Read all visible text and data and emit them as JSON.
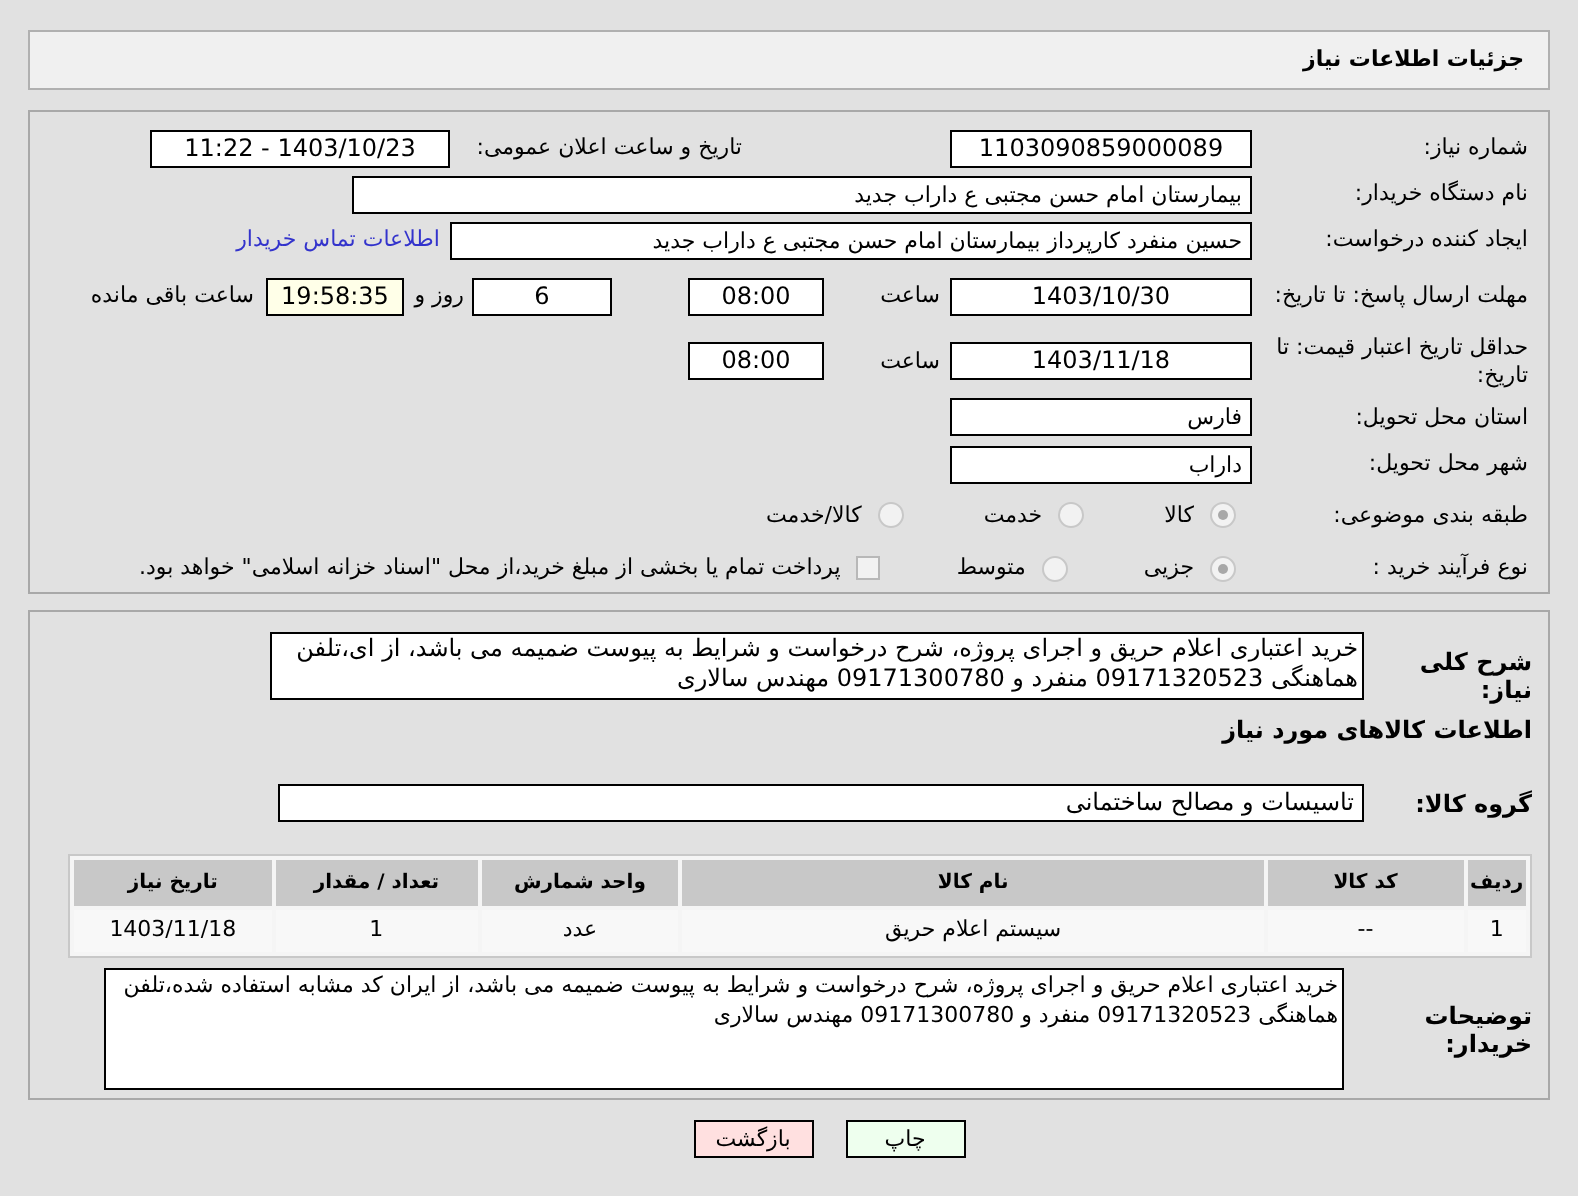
{
  "header": {
    "title": "جزئیات اطلاعات نیاز"
  },
  "need_number": {
    "label": "شماره نیاز:",
    "value": "1103090859000089"
  },
  "announce": {
    "label": "تاریخ و ساعت اعلان عمومی:",
    "value": "1403/10/23 - 11:22"
  },
  "buyer_org": {
    "label": "نام دستگاه خریدار:",
    "value": "بیمارستان امام حسن مجتبی  ع  داراب جدید"
  },
  "requester": {
    "label": "ایجاد کننده درخواست:",
    "value": "حسین  منفرد کارپرداز بیمارستان امام حسن مجتبی  ع  داراب جدید",
    "link": "اطلاعات تماس خریدار"
  },
  "deadline": {
    "label": "مهلت ارسال پاسخ: تا تاریخ:",
    "date": "1403/10/30",
    "time_label": "ساعت",
    "time": "08:00",
    "days": "6",
    "days_label": "روز و",
    "remaining": "19:58:35",
    "remaining_label": "ساعت باقی مانده"
  },
  "validity": {
    "label": "حداقل تاریخ اعتبار قیمت: تا تاریخ:",
    "date": "1403/11/18",
    "time_label": "ساعت",
    "time": "08:00"
  },
  "province": {
    "label": "استان محل تحویل:",
    "value": "فارس"
  },
  "city": {
    "label": "شهر محل تحویل:",
    "value": "داراب"
  },
  "category": {
    "label": "طبقه بندی موضوعی:",
    "options": [
      {
        "label": "کالا",
        "selected": true
      },
      {
        "label": "خدمت",
        "selected": false
      },
      {
        "label": "کالا/خدمت",
        "selected": false
      }
    ]
  },
  "process": {
    "label": "نوع فرآیند خرید :",
    "options": [
      {
        "label": "جزیی",
        "selected": true
      },
      {
        "label": "متوسط",
        "selected": false
      }
    ],
    "payment": {
      "checked": false,
      "text": "پرداخت تمام یا بخشی از مبلغ خرید،از محل \"اسناد خزانه اسلامی\" خواهد بود."
    }
  },
  "description": {
    "label": "شرح کلی نیاز:",
    "value": "خرید اعتباری اعلام حریق و اجرای پروژه، شرح درخواست و شرایط به پیوست ضمیمه می باشد، از ای،تلفن هماهنگی 09171320523 منفرد و 09171300780 مهندس سالاری"
  },
  "goods_title": "اطلاعات کالاهای مورد نیاز",
  "goods_group": {
    "label": "گروه کالا:",
    "value": "تاسیسات و مصالح ساختمانی"
  },
  "table": {
    "columns": [
      "ردیف",
      "کد کالا",
      "نام کالا",
      "واحد شمارش",
      "تعداد / مقدار",
      "تاریخ نیاز"
    ],
    "rows": [
      [
        "1",
        "--",
        "سیستم اعلام حریق",
        "عدد",
        "1",
        "1403/11/18"
      ]
    ]
  },
  "buyer_notes": {
    "label": "توضیحات خریدار:",
    "value": "خرید اعتباری اعلام حریق و اجرای پروژه، شرح درخواست و شرایط به پیوست ضمیمه می باشد، از ایران کد مشابه استفاده شده،تلفن هماهنگی 09171320523 منفرد و 09171300780 مهندس سالاری"
  },
  "buttons": [
    {
      "label": "چاپ",
      "kind": "print"
    },
    {
      "label": "بازگشت",
      "kind": "back"
    }
  ]
}
